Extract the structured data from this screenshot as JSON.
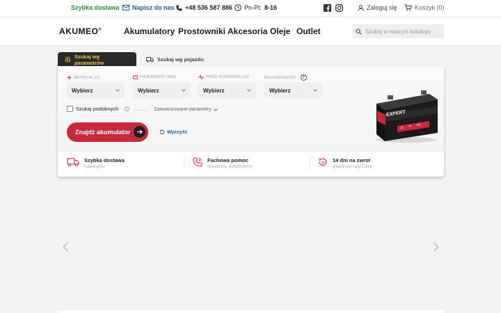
{
  "topbar": {
    "delivery": "Szybka dostawa",
    "write": "Napisz do nas",
    "phone": "+48 536 587 886",
    "hours_label": "Pn-Pt:",
    "hours_value": "8-16",
    "login": "Zaloguj się",
    "cart": "Koszyk (0)"
  },
  "header": {
    "logo": "AKUMEO",
    "nav": [
      "Akumulatory",
      "Prostowniki",
      "Akcesoria",
      "Oleje",
      "Outlet"
    ],
    "search_placeholder": "Szukaj w naszym katalogu"
  },
  "tabs": {
    "params": "Szukaj wg parametrów",
    "vehicle": "Szukaj wg pojazdu"
  },
  "filters": [
    {
      "label": "NAPIĘCIE [V]",
      "value": "Wybierz",
      "icon": "voltage-icon",
      "color": "#d63a4a"
    },
    {
      "label": "POJEMNOŚĆ [AH]",
      "value": "Wybierz",
      "icon": "battery-icon",
      "color": "#d63a4a"
    },
    {
      "label": "PRĄD ROZRUCHU [A]",
      "value": "Wybierz",
      "icon": "pulse-icon",
      "color": "#d63a4a"
    },
    {
      "label": "BIEGUNOWOŚĆ",
      "value": "Wybierz",
      "icon": "help-icon",
      "color": "#1d5fa5"
    }
  ],
  "options": {
    "similar": "Szukaj podobnych",
    "advanced": "Zaawansowane parametry"
  },
  "actions": {
    "find": "Znajdź akumulator",
    "clear": "Wyczyść"
  },
  "battery": {
    "brand": "EXPERT",
    "specs": [
      "12",
      "74",
      "700"
    ]
  },
  "features": [
    {
      "title": "Szybka dostawa",
      "subtitle": "nawet jutro",
      "icon": "truck-icon"
    },
    {
      "title": "Fachowa pomoc",
      "subtitle": "doradzimy, podpowiemy",
      "icon": "phone-help-icon"
    },
    {
      "title": "14 dni na zwrot",
      "subtitle": "gwarancja satysfakcji",
      "icon": "return-icon"
    }
  ],
  "colors": {
    "accent_red": "#c8283a",
    "tab_bg": "#2a2a2a",
    "tab_text": "#f0c23b",
    "link_blue": "#1d5fa5",
    "green": "#2e8b3a"
  }
}
